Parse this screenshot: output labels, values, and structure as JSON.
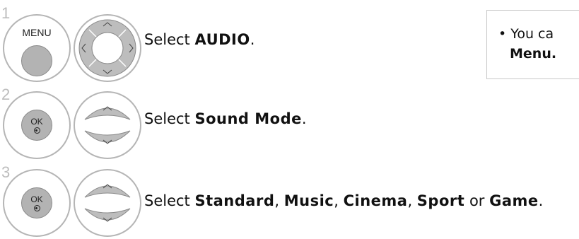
{
  "steps": [
    {
      "number": "1",
      "button_label": "MENU",
      "prefix": "Select ",
      "targets": [
        "AUDIO"
      ],
      "suffix": "."
    },
    {
      "number": "2",
      "button_label": "OK",
      "prefix": "Select ",
      "targets": [
        "Sound Mode"
      ],
      "suffix": "."
    },
    {
      "number": "3",
      "button_label": "OK",
      "prefix": "Select ",
      "options": [
        "Standard",
        "Music",
        "Cinema",
        "Sport"
      ],
      "sep": ", ",
      "or": " or ",
      "last": "Game",
      "suffix": "."
    }
  ],
  "note": {
    "bullet": "•",
    "line1": "You ca",
    "line2": "Menu."
  }
}
